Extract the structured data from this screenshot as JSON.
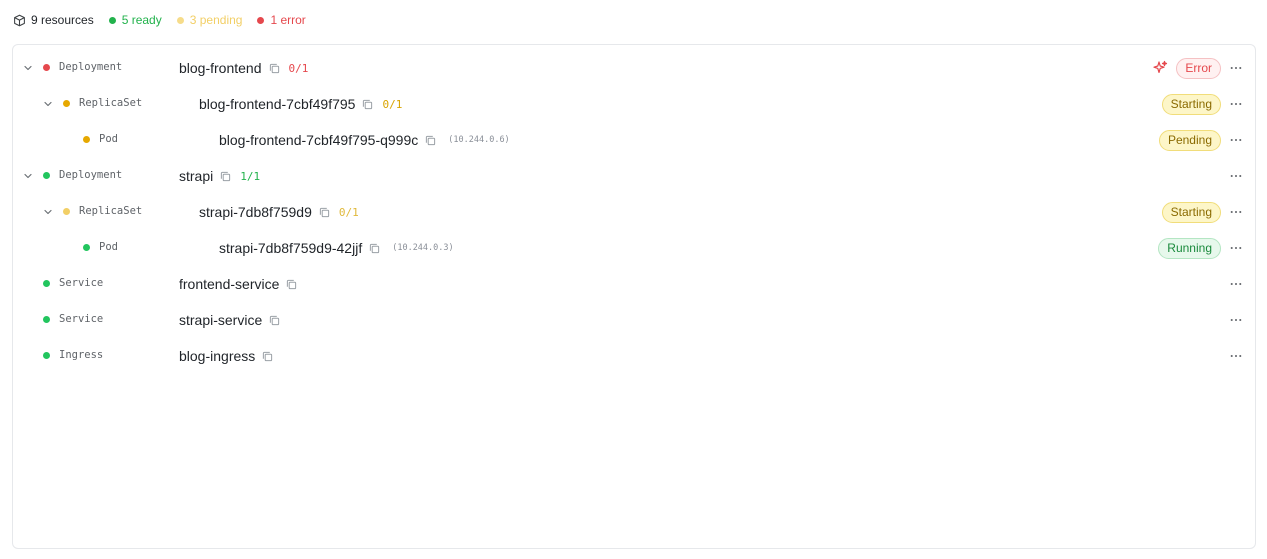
{
  "summary": {
    "resources": "9 resources",
    "ready": "5 ready",
    "pending": "3 pending",
    "error": "1 error",
    "cube_icon": "cube-icon",
    "colors": {
      "ready": "#22b24c",
      "pending": "#f2cf66",
      "error": "#e5484d"
    }
  },
  "rows": [
    {
      "kind": "Deployment",
      "name": "blog-frontend",
      "count": "0/1",
      "status": "Error",
      "level": 0,
      "expandable": true,
      "dot": "error"
    },
    {
      "kind": "ReplicaSet",
      "name": "blog-frontend-7cbf49f795",
      "count": "0/1",
      "status": "Starting",
      "level": 1,
      "expandable": true,
      "dot": "warn"
    },
    {
      "kind": "Pod",
      "name": "blog-frontend-7cbf49f795-q999c",
      "ip": "(10.244.0.6)",
      "status": "Pending",
      "level": 2,
      "expandable": false,
      "dot": "warn"
    },
    {
      "kind": "Deployment",
      "name": "strapi",
      "count": "1/1",
      "level": 0,
      "expandable": true,
      "dot": "ready"
    },
    {
      "kind": "ReplicaSet",
      "name": "strapi-7db8f759d9",
      "count": "0/1",
      "status": "Starting",
      "level": 1,
      "expandable": true,
      "dot": "pending"
    },
    {
      "kind": "Pod",
      "name": "strapi-7db8f759d9-42jjf",
      "ip": "(10.244.0.3)",
      "status": "Running",
      "level": 2,
      "expandable": false,
      "dot": "ready"
    },
    {
      "kind": "Service",
      "name": "frontend-service",
      "level": 0,
      "expandable": false,
      "dot": "ready"
    },
    {
      "kind": "Service",
      "name": "strapi-service",
      "level": 0,
      "expandable": false,
      "dot": "ready"
    },
    {
      "kind": "Ingress",
      "name": "blog-ingress",
      "level": 0,
      "expandable": false,
      "dot": "ready"
    }
  ]
}
